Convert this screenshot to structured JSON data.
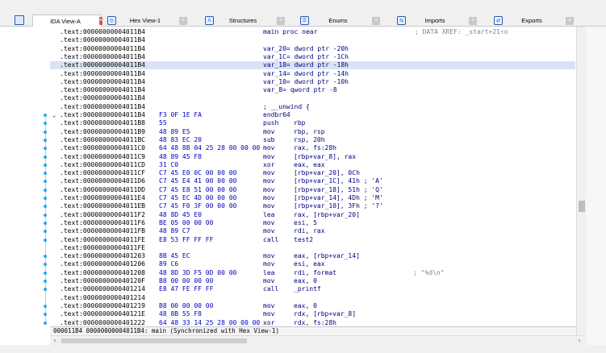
{
  "tabs": [
    {
      "label": "IDA View-A",
      "icon": "ida-view-icon",
      "active": true
    },
    {
      "label": "Hex View-1",
      "icon": "hex-view-icon",
      "active": false
    },
    {
      "label": "Structures",
      "icon": "structures-icon",
      "active": false
    },
    {
      "label": "Enums",
      "icon": "enums-icon",
      "active": false
    },
    {
      "label": "Imports",
      "icon": "imports-icon",
      "active": false
    },
    {
      "label": "Exports",
      "icon": "exports-icon",
      "active": false
    }
  ],
  "listing": [
    {
      "addr": ".text:00000000004011B4",
      "full": "main proc near",
      "xref": "; DATA XREF: _start+21↑o"
    },
    {
      "addr": ".text:00000000004011B4"
    },
    {
      "addr": ".text:00000000004011B4",
      "full": "var_20= dword ptr -20h"
    },
    {
      "addr": ".text:00000000004011B4",
      "full": "var_1C= dword ptr -1Ch"
    },
    {
      "addr": ".text:00000000004011B4",
      "full": "var_18= dword ptr -18h",
      "hl": true
    },
    {
      "addr": ".text:00000000004011B4",
      "full": "var_14= dword ptr -14h"
    },
    {
      "addr": ".text:00000000004011B4",
      "full": "var_10= dword ptr -10h"
    },
    {
      "addr": ".text:00000000004011B4",
      "full": "var_8= qword ptr -8"
    },
    {
      "addr": ".text:00000000004011B4"
    },
    {
      "addr": ".text:00000000004011B4",
      "full": "; __unwind {"
    },
    {
      "addr": ".text:00000000004011B4",
      "bytes": "F3 0F 1E FA",
      "mnem": "endbr64",
      "arrow": true
    },
    {
      "addr": ".text:00000000004011B8",
      "bytes": "55",
      "mnem": "push",
      "ops": "rbp"
    },
    {
      "addr": ".text:00000000004011B9",
      "bytes": "48 89 E5",
      "mnem": "mov",
      "ops": "rbp, rsp"
    },
    {
      "addr": ".text:00000000004011BC",
      "bytes": "48 83 EC 20",
      "mnem": "sub",
      "ops": "rsp, 20h"
    },
    {
      "addr": ".text:00000000004011C0",
      "bytes": "64 48 8B 04 25 28 00 00 00",
      "mnem": "mov",
      "ops": "rax, fs:28h"
    },
    {
      "addr": ".text:00000000004011C9",
      "bytes": "48 89 45 F8",
      "mnem": "mov",
      "ops": "[rbp+var_8], rax"
    },
    {
      "addr": ".text:00000000004011CD",
      "bytes": "31 C0",
      "mnem": "xor",
      "ops": "eax, eax"
    },
    {
      "addr": ".text:00000000004011CF",
      "bytes": "C7 45 E0 0C 00 00 00",
      "mnem": "mov",
      "ops": "[rbp+var_20], 0Ch"
    },
    {
      "addr": ".text:00000000004011D6",
      "bytes": "C7 45 E4 41 00 00 00",
      "mnem": "mov",
      "ops": "[rbp+var_1C], 41h ; 'A'"
    },
    {
      "addr": ".text:00000000004011DD",
      "bytes": "C7 45 E8 51 00 00 00",
      "mnem": "mov",
      "ops": "[rbp+var_18], 51h ; 'Q'"
    },
    {
      "addr": ".text:00000000004011E4",
      "bytes": "C7 45 EC 4D 00 00 00",
      "mnem": "mov",
      "ops": "[rbp+var_14], 4Dh ; 'M'"
    },
    {
      "addr": ".text:00000000004011EB",
      "bytes": "C7 45 F0 3F 00 00 00",
      "mnem": "mov",
      "ops": "[rbp+var_10], 3Fh ; '?'"
    },
    {
      "addr": ".text:00000000004011F2",
      "bytes": "48 8D 45 E0",
      "mnem": "lea",
      "ops": "rax, [rbp+var_20]"
    },
    {
      "addr": ".text:00000000004011F6",
      "bytes": "BE 05 00 00 00",
      "mnem": "mov",
      "ops": "esi, 5"
    },
    {
      "addr": ".text:00000000004011FB",
      "bytes": "48 89 C7",
      "mnem": "mov",
      "ops": "rdi, rax"
    },
    {
      "addr": ".text:00000000004011FE",
      "bytes": "E8 53 FF FF FF",
      "mnem": "call",
      "ops": "test2"
    },
    {
      "addr": ".text:00000000004011FE"
    },
    {
      "addr": ".text:0000000000401203",
      "bytes": "8B 45 EC",
      "mnem": "mov",
      "ops": "eax, [rbp+var_14]"
    },
    {
      "addr": ".text:0000000000401206",
      "bytes": "89 C6",
      "mnem": "mov",
      "ops": "esi, eax"
    },
    {
      "addr": ".text:0000000000401208",
      "bytes": "48 8D 3D F5 0D 00 00",
      "mnem": "lea",
      "ops": "rdi, format",
      "cmt": "; \"%d\\n\""
    },
    {
      "addr": ".text:000000000040120F",
      "bytes": "B8 00 00 00 00",
      "mnem": "mov",
      "ops": "eax, 0"
    },
    {
      "addr": ".text:0000000000401214",
      "bytes": "E8 47 FE FF FF",
      "mnem": "call",
      "ops": "_printf"
    },
    {
      "addr": ".text:0000000000401214"
    },
    {
      "addr": ".text:0000000000401219",
      "bytes": "B8 00 00 00 00",
      "mnem": "mov",
      "ops": "eax, 0"
    },
    {
      "addr": ".text:000000000040121E",
      "bytes": "48 8B 55 F8",
      "mnem": "mov",
      "ops": "rdx, [rbp+var_8]"
    },
    {
      "addr": ".text:0000000000401222",
      "bytes": "64 48 33 14 25 28 00 00 00",
      "mnem": "xor",
      "ops": "rdx, fs:28h"
    }
  ],
  "status": {
    "text": "000011B4 00000000004011B4: main (Synchronized with Hex View-1)"
  },
  "colors": {
    "address": "#000000",
    "bytes": "#0000c0",
    "instruction": "#000080",
    "comment": "#8080a0",
    "highlight": "#d8e4f4",
    "active_close": "#e05050"
  }
}
